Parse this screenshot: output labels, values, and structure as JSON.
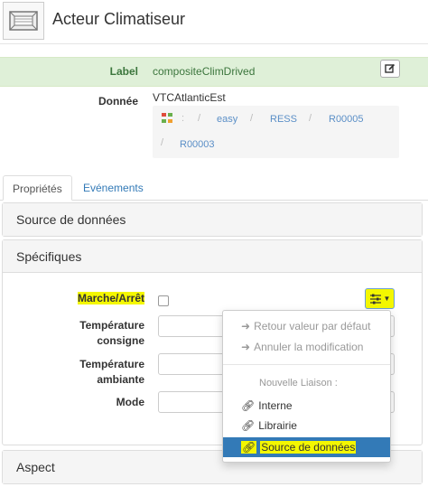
{
  "header": {
    "title": "Acteur Climatiseur",
    "icon": "air-conditioner-icon"
  },
  "label_row": {
    "key": "Label",
    "value": "compositeClimDrived",
    "edit_icon": "edit-icon"
  },
  "donnee": {
    "key": "Donnée",
    "value": "VTCAtlanticEst",
    "breadcrumb": [
      ":",
      "/",
      "easy",
      "/",
      "RESS",
      "/",
      "R00005",
      "/",
      "R00003"
    ]
  },
  "tabs": [
    {
      "label": "Propriétés"
    },
    {
      "label": "Evénements"
    }
  ],
  "panels": {
    "source": "Source de données",
    "specifiques": "Spécifiques",
    "aspect": "Aspect"
  },
  "fields": {
    "marche": "Marche/Arrêt",
    "temp_consigne_1": "Température",
    "temp_consigne_2": "consigne",
    "temp_ambiante_1": "Température",
    "temp_ambiante_2": "ambiante",
    "mode": "Mode"
  },
  "dropdown": {
    "retour": "Retour valeur par défaut",
    "annuler": "Annuler la modification",
    "header": "Nouvelle Liaison :",
    "interne": "Interne",
    "librairie": "Librairie",
    "source": "Source de données"
  },
  "colors": {
    "highlight": "#f4f700",
    "accent": "#337ab7",
    "success_bg": "#dff0d8"
  }
}
